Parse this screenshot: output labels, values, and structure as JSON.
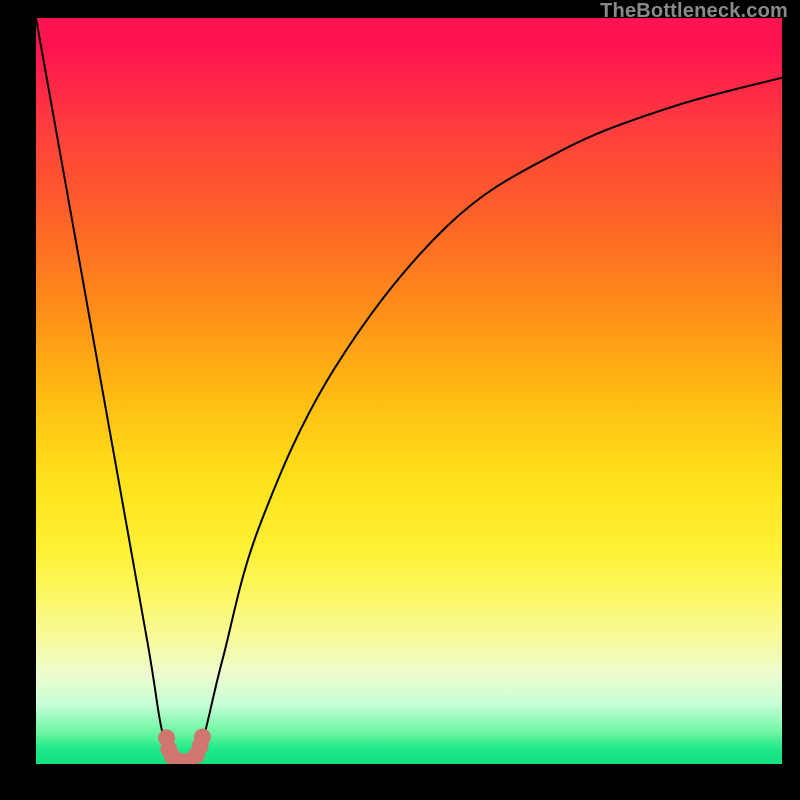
{
  "watermark": {
    "text": "TheBottleneck.com"
  },
  "chart_data": {
    "type": "line",
    "title": "",
    "xlabel": "",
    "ylabel": "",
    "xlim": [
      0,
      100
    ],
    "ylim": [
      0,
      100
    ],
    "grid": false,
    "series": [
      {
        "name": "bottleneck-curve",
        "x": [
          0,
          5,
          10,
          15,
          17,
          19,
          20,
          22,
          25,
          30,
          40,
          55,
          70,
          85,
          100
        ],
        "values": [
          100,
          72,
          44,
          16,
          4,
          0,
          0,
          2,
          14,
          32,
          53,
          72,
          82,
          88,
          92
        ]
      }
    ],
    "markers": {
      "name": "near-optimal-points",
      "x": [
        17.5,
        17.8,
        18.3,
        19.5,
        20.5,
        21.5,
        22.0,
        22.3
      ],
      "values": [
        3.5,
        2.0,
        1.0,
        0.3,
        0.4,
        1.2,
        2.4,
        3.6
      ]
    },
    "background": {
      "type": "vertical-gradient",
      "stops": [
        {
          "pos": 0,
          "color": "#ff1450"
        },
        {
          "pos": 50,
          "color": "#ffb912"
        },
        {
          "pos": 80,
          "color": "#fcf86a"
        },
        {
          "pos": 100,
          "color": "#12e07e"
        }
      ]
    }
  }
}
